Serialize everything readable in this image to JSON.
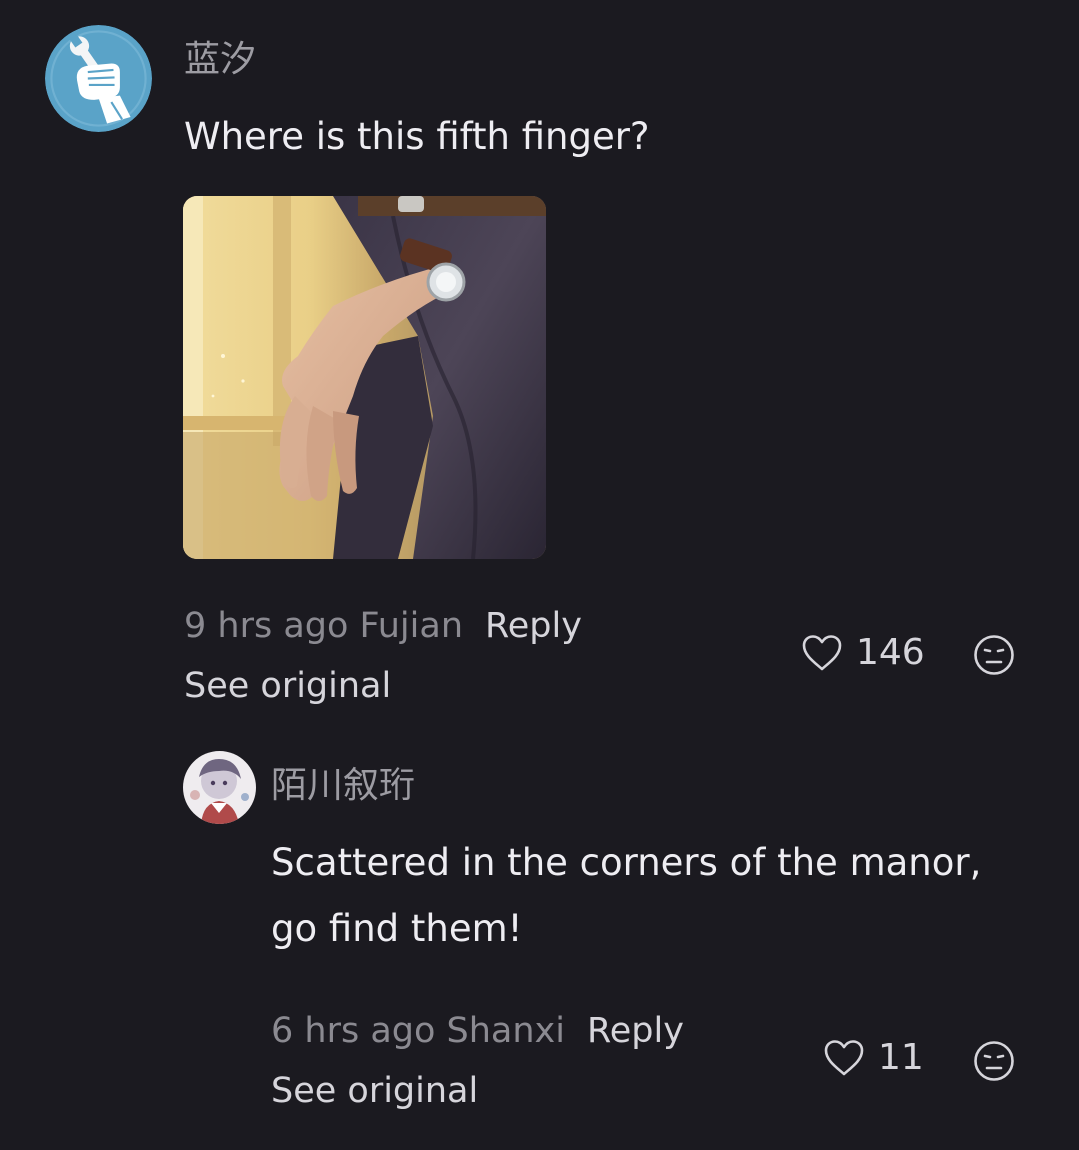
{
  "comment": {
    "username": "蓝汐",
    "text": "Where is this fifth finger?",
    "meta_time_location": "9 hrs ago Fujian",
    "reply_label": "Reply",
    "see_original_label": "See original",
    "like_count": "146",
    "avatar_icon": "fist-wrench-icon",
    "image_icon": "hand-with-watch-image"
  },
  "reply": {
    "username": "陌川叙珩",
    "text_line1": "Scattered in the corners of the manor,",
    "text_line2": "go find them!",
    "meta_time_location": "6 hrs ago Shanxi",
    "reply_label": "Reply",
    "see_original_label": "See original",
    "like_count": "11",
    "avatar_icon": "anime-character-avatar"
  },
  "colors": {
    "background": "#1b1a20",
    "text_primary": "#eeedf2",
    "text_secondary": "#8b8a91",
    "avatar_blue": "#5aa3c8"
  }
}
